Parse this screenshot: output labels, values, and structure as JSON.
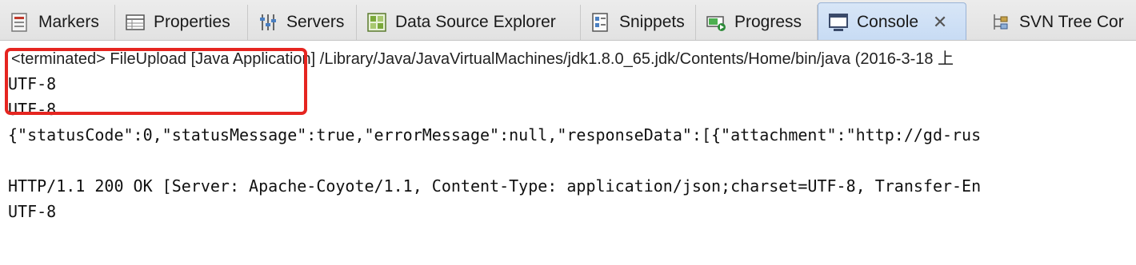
{
  "tabs": [
    {
      "label": "Markers",
      "icon": "markers-icon"
    },
    {
      "label": "Properties",
      "icon": "properties-icon"
    },
    {
      "label": "Servers",
      "icon": "servers-icon"
    },
    {
      "label": "Data Source Explorer",
      "icon": "data-source-explorer-icon"
    },
    {
      "label": "Snippets",
      "icon": "snippets-icon"
    },
    {
      "label": "Progress",
      "icon": "progress-icon"
    },
    {
      "label": "Console",
      "icon": "console-icon",
      "active": true,
      "close": "✕"
    },
    {
      "label": "SVN Tree Cor",
      "icon": "svn-tree-icon"
    }
  ],
  "console": {
    "header": "<terminated> FileUpload [Java Application] /Library/Java/JavaVirtualMachines/jdk1.8.0_65.jdk/Contents/Home/bin/java (2016-3-18 上",
    "lines": [
      "UTF-8",
      "UTF-8",
      "{\"statusCode\":0,\"statusMessage\":true,\"errorMessage\":null,\"responseData\":[{\"attachment\":\"http://gd-rus",
      "",
      "HTTP/1.1 200 OK [Server: Apache-Coyote/1.1, Content-Type: application/json;charset=UTF-8, Transfer-En",
      "UTF-8"
    ]
  },
  "colors": {
    "highlight": "#e52520",
    "active_tab": "#c7dbf4"
  }
}
